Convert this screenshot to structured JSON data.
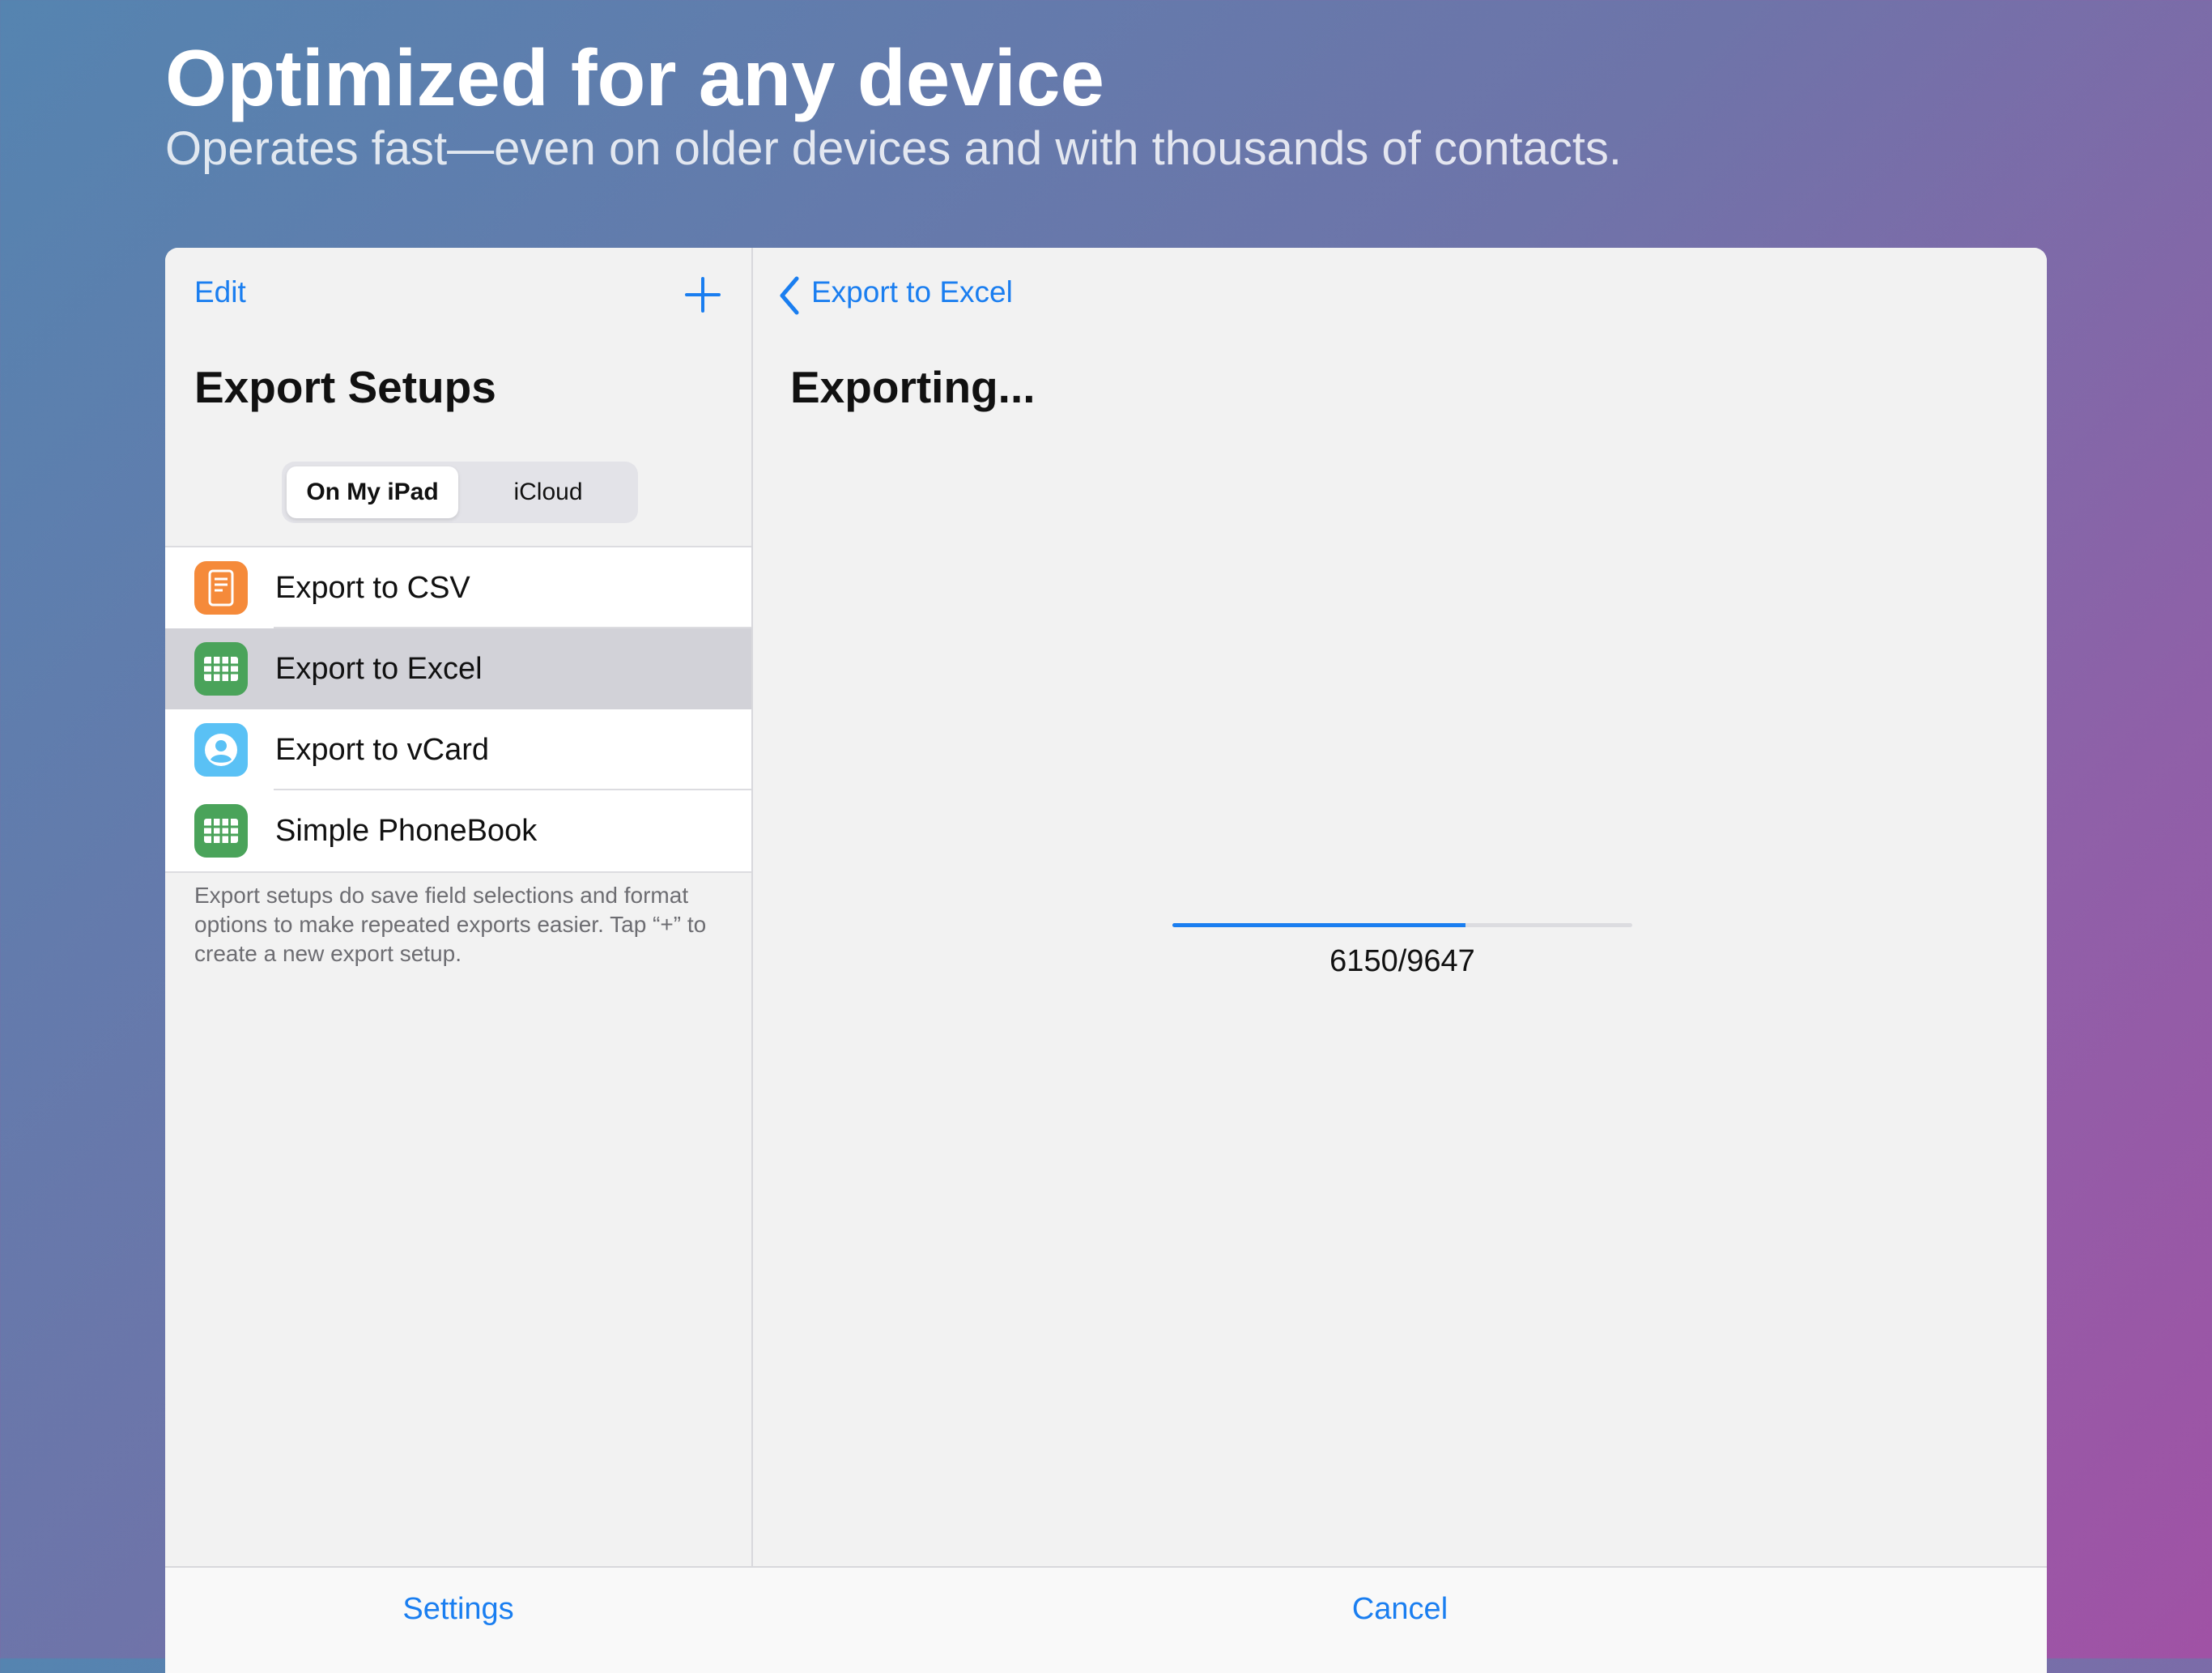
{
  "headline": "Optimized for any device",
  "subheadline": "Operates fast—even on older devices and with thousands of contacts.",
  "sidebar": {
    "edit_label": "Edit",
    "title": "Export Setups",
    "segments": [
      {
        "label": "On My iPad",
        "selected": true
      },
      {
        "label": "iCloud",
        "selected": false
      }
    ],
    "items": [
      {
        "label": "Export to CSV",
        "icon": "document-icon",
        "color": "#f58a3a"
      },
      {
        "label": "Export to Excel",
        "icon": "grid-icon",
        "color": "#4aa35a",
        "selected": true
      },
      {
        "label": "Export to vCard",
        "icon": "contact-icon",
        "color": "#5ac1f5"
      },
      {
        "label": "Simple PhoneBook",
        "icon": "grid-icon",
        "color": "#4aa35a"
      }
    ],
    "footer_note": "Export setups do save field selections and format options to make repeated exports easier. Tap “+” to create a new export setup.",
    "settings_label": "Settings"
  },
  "detail": {
    "back_label": "Export to Excel",
    "title": "Exporting...",
    "progress": {
      "current": 6150,
      "total": 9647,
      "text": "6150/9647"
    },
    "cancel_label": "Cancel"
  },
  "colors": {
    "accent": "#1a7ef0",
    "selected_row": "#d2d2d8"
  }
}
